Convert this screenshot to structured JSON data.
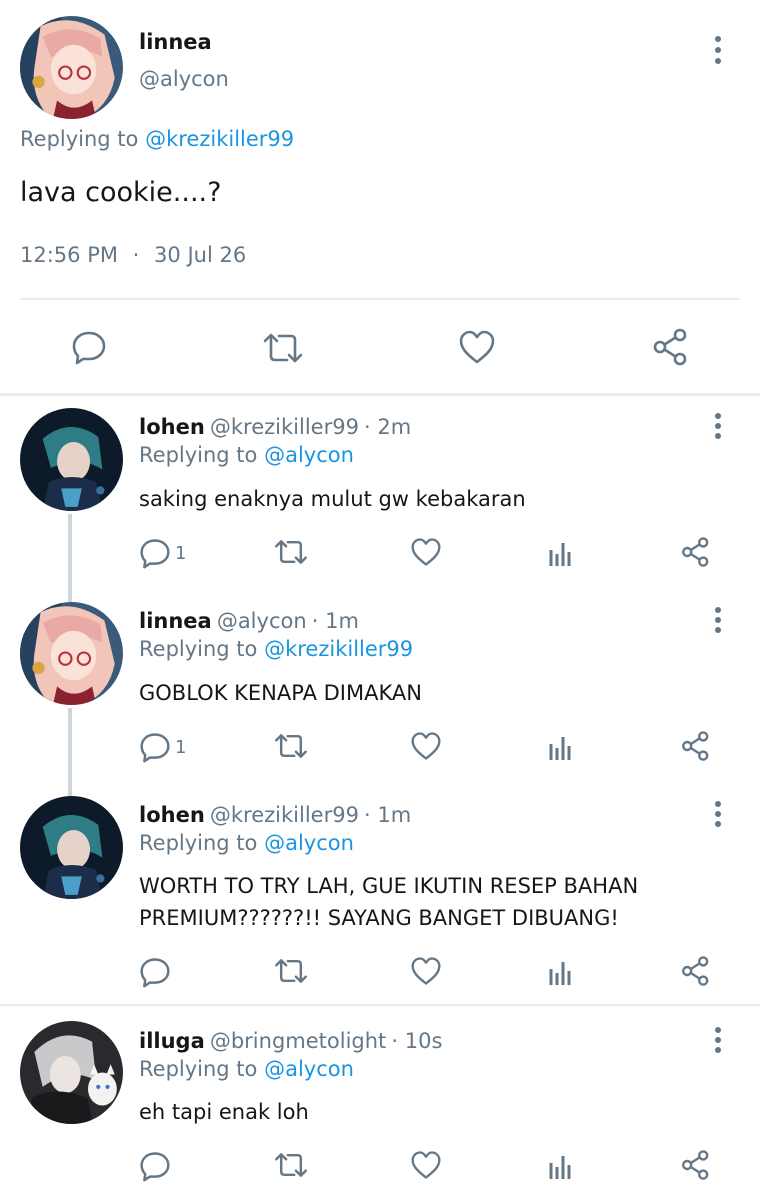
{
  "main_tweet": {
    "name": "linnea",
    "handle": "@alycon",
    "replying_prefix": "Replying to",
    "replying_to": "@krezikiller99",
    "text": "lava cookie....?",
    "time": "12:56 PM",
    "separator": "·",
    "date": "30 Jul 26"
  },
  "replies": [
    {
      "name": "lohen",
      "handle": "@krezikiller99",
      "age": "· 2m",
      "replying_prefix": "Replying to",
      "replying_to": "@alycon",
      "text_lines": [
        "saking enaknya mulut gw kebakaran"
      ],
      "reply_count": "1"
    },
    {
      "name": "linnea",
      "handle": "@alycon",
      "age": "· 1m",
      "replying_prefix": "Replying to",
      "replying_to": "@krezikiller99",
      "text_lines": [
        "GOBLOK KENAPA DIMAKAN"
      ],
      "reply_count": "1"
    },
    {
      "name": "lohen",
      "handle": "@krezikiller99",
      "age": "· 1m",
      "replying_prefix": "Replying to",
      "replying_to": "@alycon",
      "text_lines": [
        "WORTH TO TRY LAH, GUE IKUTIN RESEP BAHAN",
        "PREMIUM??????!! SAYANG BANGET DIBUANG!"
      ],
      "reply_count": ""
    },
    {
      "name": "illuga",
      "handle": "@bringmetolight",
      "age": "· 10s",
      "replying_prefix": "Replying to",
      "replying_to": "@alycon",
      "text_lines": [
        "eh tapi enak loh"
      ],
      "reply_count": ""
    }
  ],
  "colors": {
    "link": "#1b95e0",
    "muted": "#657786",
    "divider": "#e6ecf0",
    "thread_line": "#ccd6dd"
  }
}
